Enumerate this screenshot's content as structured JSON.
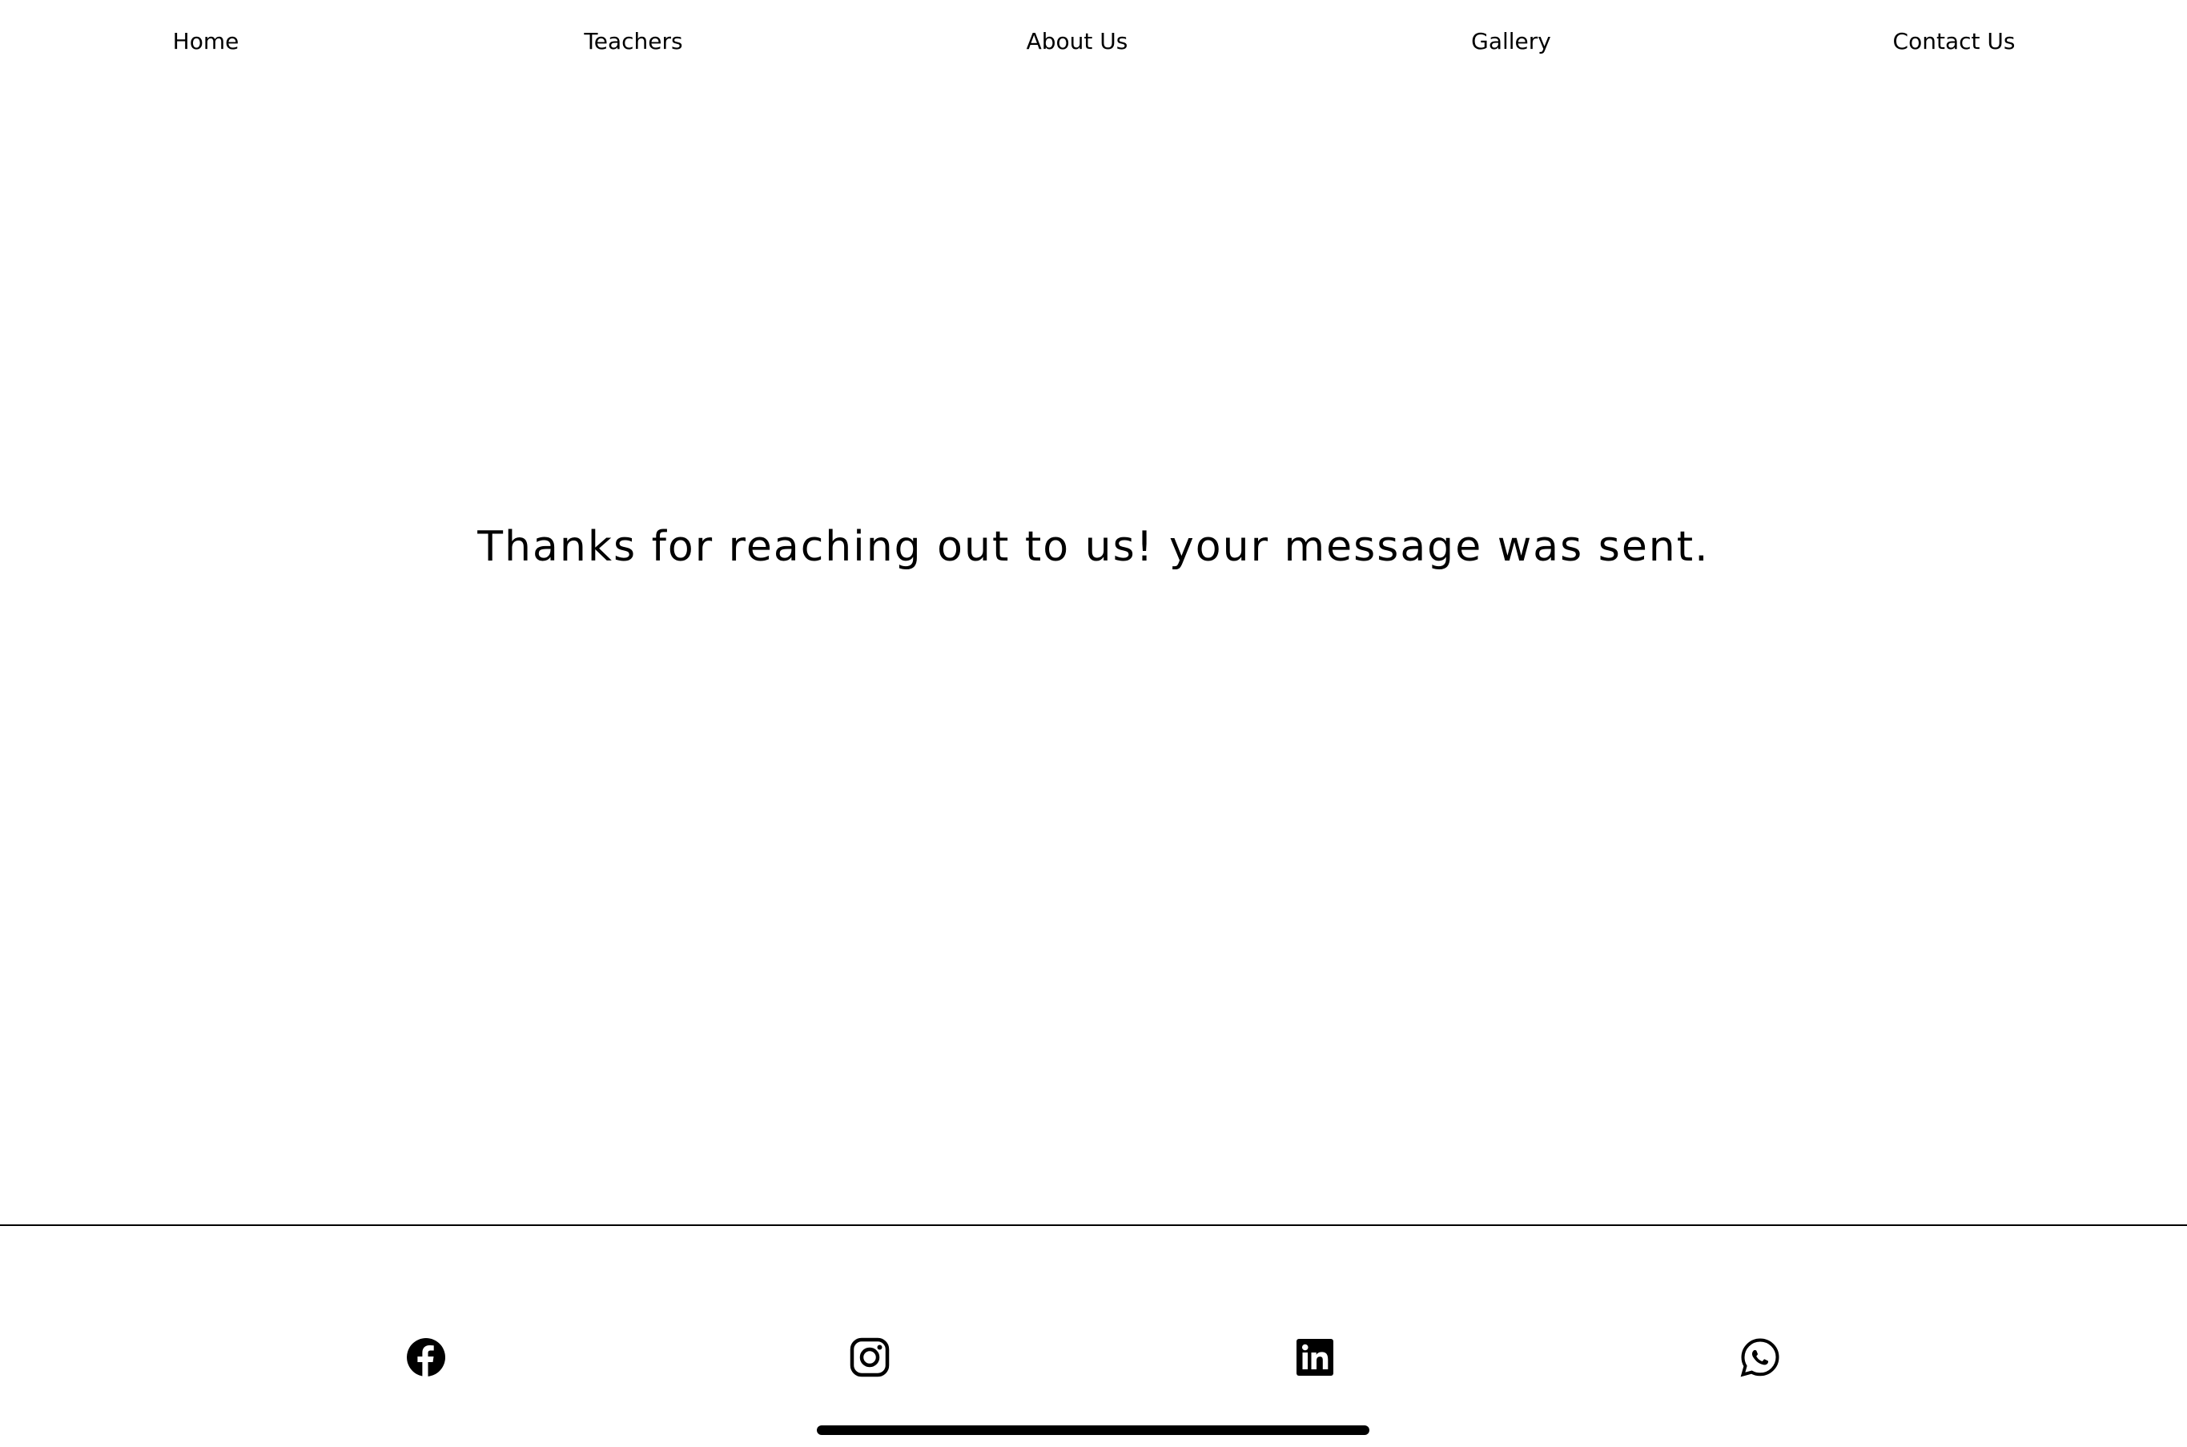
{
  "nav": {
    "items": [
      {
        "label": "Home"
      },
      {
        "label": "Teachers"
      },
      {
        "label": "About Us"
      },
      {
        "label": "Gallery"
      },
      {
        "label": "Contact Us"
      }
    ]
  },
  "main": {
    "message": "Thanks for reaching out to us! your message was sent."
  },
  "footer": {
    "social_icons": [
      "facebook-icon",
      "instagram-icon",
      "linkedin-icon",
      "whatsapp-icon"
    ]
  },
  "colors": {
    "background": "#ffffff",
    "foreground": "#000000"
  }
}
